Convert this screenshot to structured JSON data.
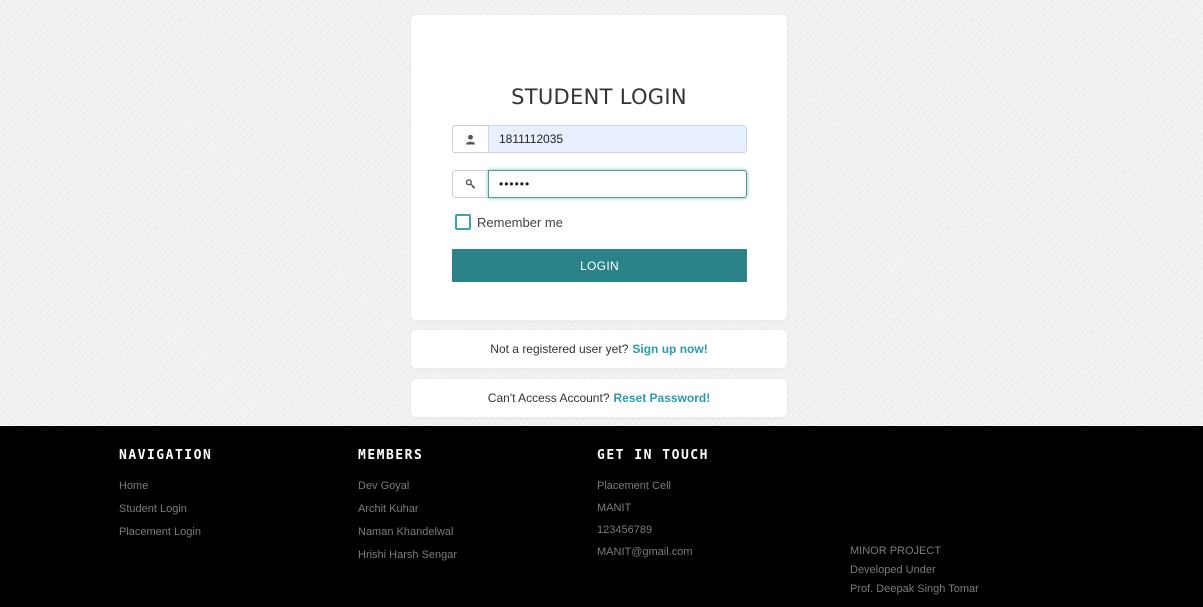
{
  "login": {
    "title": "STUDENT LOGIN",
    "username_value": "1811112035",
    "password_value": "••••••",
    "remember_label": "Remember me",
    "login_button": "LOGIN"
  },
  "signup": {
    "prompt": "Not a registered user yet?",
    "link": "Sign up now!"
  },
  "reset": {
    "prompt": "Can't Access Account?",
    "link": "Reset Password!"
  },
  "footer": {
    "navigation": {
      "heading": "NAVIGATION",
      "items": [
        "Home",
        "Student Login",
        "Placement Login"
      ]
    },
    "members": {
      "heading": "MEMBERS",
      "items": [
        "Dev Goyal",
        "Archit Kuhar",
        "Naman Khandelwal",
        "Hrishi Harsh Sengar"
      ]
    },
    "contact": {
      "heading": "GET IN TOUCH",
      "items": [
        "Placement Cell",
        "MANIT",
        "123456789",
        "MANIT@gmail.com"
      ]
    },
    "credits": [
      "MINOR PROJECT",
      "Developed Under",
      "Prof. Deepak Singh Tomar"
    ]
  },
  "colors": {
    "accent": "#2b8289",
    "link": "#2a9ab0",
    "footer_bg": "#000000"
  },
  "icons": {
    "username": "user-icon",
    "password": "key-icon"
  }
}
